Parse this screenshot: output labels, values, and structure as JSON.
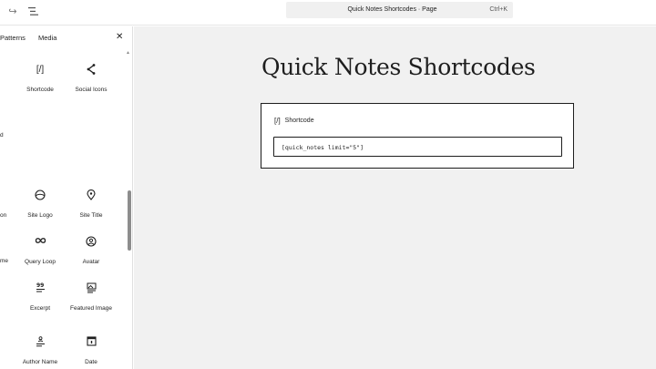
{
  "topbar": {
    "command_title": "Quick Notes Shortcodes · Page",
    "command_shortcut": "Ctrl+K",
    "icons": {
      "redo": "redo-icon",
      "document_overview": "list-view-icon"
    }
  },
  "sidebar": {
    "tabs": [
      {
        "label": "Patterns"
      },
      {
        "label": "Media"
      }
    ],
    "close_icon": "close-icon",
    "partial_labels": [
      "d",
      "on",
      "me"
    ],
    "blocks": [
      {
        "label": "Shortcode",
        "icon": "shortcode-icon"
      },
      {
        "label": "Social Icons",
        "icon": "share-icon"
      },
      {
        "label": "Site Logo",
        "icon": "site-logo-icon"
      },
      {
        "label": "Site Title",
        "icon": "map-marker-icon"
      },
      {
        "label": "Query Loop",
        "icon": "loop-icon"
      },
      {
        "label": "Avatar",
        "icon": "avatar-icon"
      },
      {
        "label": "Excerpt",
        "icon": "excerpt-icon"
      },
      {
        "label": "Featured Image",
        "icon": "featured-image-icon"
      },
      {
        "label": "Author Name",
        "icon": "author-name-icon"
      },
      {
        "label": "Date",
        "icon": "calendar-icon"
      }
    ]
  },
  "canvas": {
    "page_title": "Quick Notes Shortcodes",
    "shortcode_block": {
      "icon_text": "[/]",
      "label": "Shortcode",
      "value": "[quick_notes limit=\"5\"]"
    }
  }
}
